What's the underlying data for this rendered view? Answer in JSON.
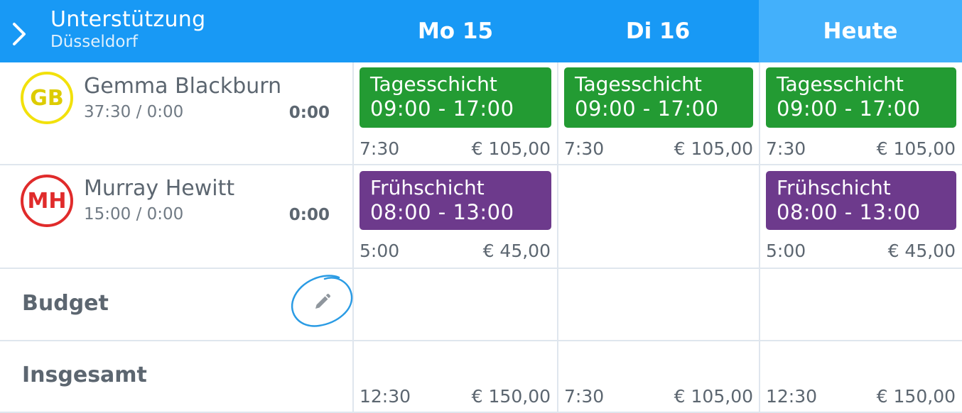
{
  "header": {
    "back_icon": "chevron-right-icon",
    "title": "Unterstützung",
    "subtitle": "Düsseldorf",
    "days": [
      "Mo 15",
      "Di 16",
      "Heute"
    ],
    "color": "#1899f5",
    "today_color": "#43b0fb"
  },
  "employees": [
    {
      "initials": "GB",
      "name": "Gemma Blackburn",
      "hours": "37:30 / 0:00",
      "total": "0:00",
      "avatar_color": "#f2e10c",
      "days": [
        {
          "shift": "Tagesschicht",
          "time": "09:00 - 17:00",
          "hours": "7:30",
          "cost": "€ 105,00",
          "color": "#239b33"
        },
        {
          "shift": "Tagesschicht",
          "time": "09:00 - 17:00",
          "hours": "7:30",
          "cost": "€ 105,00",
          "color": "#239b33"
        },
        {
          "shift": "Tagesschicht",
          "time": "09:00 - 17:00",
          "hours": "7:30",
          "cost": "€ 105,00",
          "color": "#239b33"
        }
      ]
    },
    {
      "initials": "MH",
      "name": "Murray Hewitt",
      "hours": "15:00 / 0:00",
      "total": "0:00",
      "avatar_color": "#e02b2b",
      "days": [
        {
          "shift": "Frühschicht",
          "time": "08:00 - 13:00",
          "hours": "5:00",
          "cost": "€ 45,00",
          "color": "#6d3a8c"
        },
        null,
        {
          "shift": "Frühschicht",
          "time": "08:00 - 13:00",
          "hours": "5:00",
          "cost": "€ 45,00",
          "color": "#6d3a8c"
        }
      ]
    }
  ],
  "budget": {
    "label": "Budget",
    "edit_icon": "pencil-icon",
    "annotation": "blue-hand-drawn-circle"
  },
  "totals": {
    "label": "Insgesamt",
    "days": [
      {
        "hours": "12:30",
        "cost": "€ 150,00"
      },
      {
        "hours": "7:30",
        "cost": "€ 105,00"
      },
      {
        "hours": "12:30",
        "cost": "€ 150,00"
      }
    ]
  }
}
